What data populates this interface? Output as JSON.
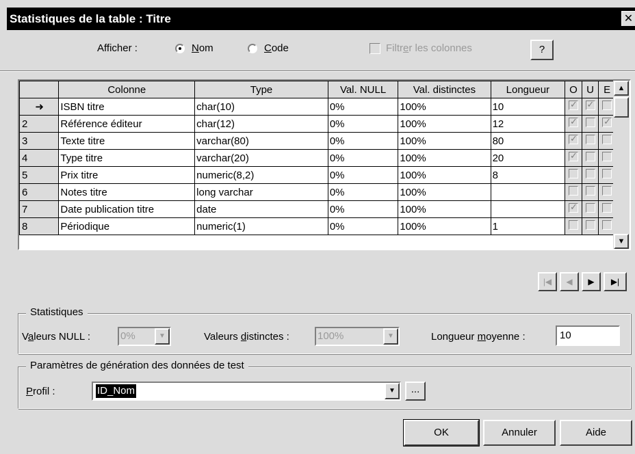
{
  "window": {
    "title": "Statistiques de la table : Titre",
    "close": "✕"
  },
  "display": {
    "label": "Afficher :",
    "options": [
      {
        "label": "Nom",
        "underline": "N",
        "rest": "om",
        "selected": true
      },
      {
        "label": "Code",
        "underline": "C",
        "rest": "ode",
        "selected": false
      }
    ],
    "filter": {
      "prefix": "Filtr",
      "underline": "e",
      "suffix": "r les colonnes",
      "checked": false,
      "disabled": true
    },
    "help": "?"
  },
  "grid": {
    "headers": [
      "",
      "Colonne",
      "Type",
      "Val. NULL",
      "Val. distinctes",
      "Longueur",
      "O",
      "U",
      "E"
    ],
    "rows": [
      {
        "marker": "➜",
        "name": "ISBN titre",
        "type": "char(10)",
        "null": "0%",
        "distinct": "100%",
        "length": "10",
        "o": true,
        "u": true,
        "e": false
      },
      {
        "marker": "2",
        "name": "Référence éditeur",
        "type": "char(12)",
        "null": "0%",
        "distinct": "100%",
        "length": "12",
        "o": true,
        "u": false,
        "e": true
      },
      {
        "marker": "3",
        "name": "Texte titre",
        "type": "varchar(80)",
        "null": "0%",
        "distinct": "100%",
        "length": "80",
        "o": true,
        "u": false,
        "e": false
      },
      {
        "marker": "4",
        "name": "Type titre",
        "type": "varchar(20)",
        "null": "0%",
        "distinct": "100%",
        "length": "20",
        "o": true,
        "u": false,
        "e": false
      },
      {
        "marker": "5",
        "name": "Prix titre",
        "type": "numeric(8,2)",
        "null": "0%",
        "distinct": "100%",
        "length": "8",
        "o": false,
        "u": false,
        "e": false
      },
      {
        "marker": "6",
        "name": "Notes titre",
        "type": "long varchar",
        "null": "0%",
        "distinct": "100%",
        "length": "",
        "o": false,
        "u": false,
        "e": false
      },
      {
        "marker": "7",
        "name": "Date publication titre",
        "type": "date",
        "null": "0%",
        "distinct": "100%",
        "length": "",
        "o": true,
        "u": false,
        "e": false
      },
      {
        "marker": "8",
        "name": "Périodique",
        "type": "numeric(1)",
        "null": "0%",
        "distinct": "100%",
        "length": "1",
        "o": false,
        "u": false,
        "e": false
      }
    ]
  },
  "nav": {
    "first": "|◀",
    "prev": "◀",
    "next": "▶",
    "last": "▶|"
  },
  "stats": {
    "legend": "Statistiques",
    "null_label_pre": "V",
    "null_label_ul": "a",
    "null_label_post": "leurs NULL :",
    "null_value": "0%",
    "distinct_label_pre": "Valeurs ",
    "distinct_label_ul": "d",
    "distinct_label_post": "istinctes :",
    "distinct_value": "100%",
    "avg_label_pre": "Longueur ",
    "avg_label_ul": "m",
    "avg_label_post": "oyenne :",
    "avg_value": "10"
  },
  "testgen": {
    "legend": "Paramètres de génération des données de test",
    "profile_ul": "P",
    "profile_post": "rofil :",
    "profile_value": "ID_Nom",
    "browse": "..."
  },
  "buttons": {
    "ok": "OK",
    "cancel": "Annuler",
    "help": "Aide"
  }
}
